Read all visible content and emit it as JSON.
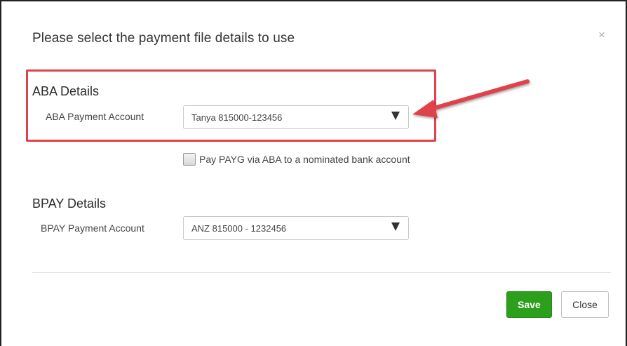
{
  "dialog": {
    "title": "Please select the payment file details to use",
    "close_glyph": "×"
  },
  "aba": {
    "section_title": "ABA Details",
    "field_label": "ABA Payment Account",
    "selected_value": "Tanya 815000-123456"
  },
  "payg": {
    "checkbox_label": "Pay PAYG via ABA to a nominated bank account",
    "checked": false
  },
  "bpay": {
    "section_title": "BPAY Details",
    "field_label": "BPAY Payment Account",
    "selected_value": "ANZ 815000 - 1232456"
  },
  "footer": {
    "save_label": "Save",
    "close_label": "Close"
  },
  "colors": {
    "highlight": "#e0424b",
    "save_button": "#2ca01c"
  },
  "icons": {
    "close": "close-icon",
    "dropdown": "chevron-down-icon",
    "annotation": "red-arrow-icon"
  }
}
